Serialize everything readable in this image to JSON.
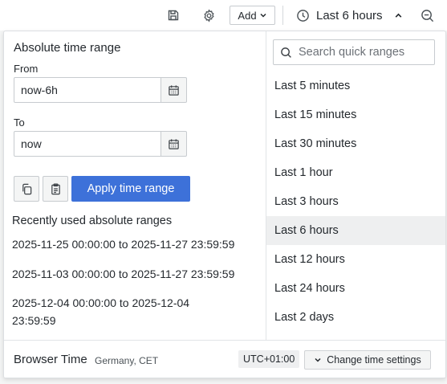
{
  "toolbar": {
    "save_icon": "save-icon",
    "settings_icon": "gear-icon",
    "add_label": "Add",
    "time_range_label": "Last 6 hours",
    "zoom_icon": "zoom-out-icon"
  },
  "absolute": {
    "title": "Absolute time range",
    "from_label": "From",
    "from_value": "now-6h",
    "to_label": "To",
    "to_value": "now",
    "apply_label": "Apply time range"
  },
  "recent": {
    "title": "Recently used absolute ranges",
    "items": [
      "2025-11-25 00:00:00 to 2025-11-27 23:59:59",
      "2025-11-03 00:00:00 to 2025-11-27 23:59:59",
      "2025-12-04 00:00:00 to 2025-12-04 23:59:59"
    ]
  },
  "quick": {
    "search_placeholder": "Search quick ranges",
    "selected": "Last 6 hours",
    "items": [
      "Last 5 minutes",
      "Last 15 minutes",
      "Last 30 minutes",
      "Last 1 hour",
      "Last 3 hours",
      "Last 6 hours",
      "Last 12 hours",
      "Last 24 hours",
      "Last 2 days"
    ]
  },
  "footer": {
    "title": "Browser Time",
    "region": "Germany, CET",
    "offset": "UTC+01:00",
    "change_label": "Change time settings"
  },
  "colors": {
    "primary": "#3d71d9",
    "selected_row": "#eeeff0",
    "background": "#f4f5f5"
  }
}
